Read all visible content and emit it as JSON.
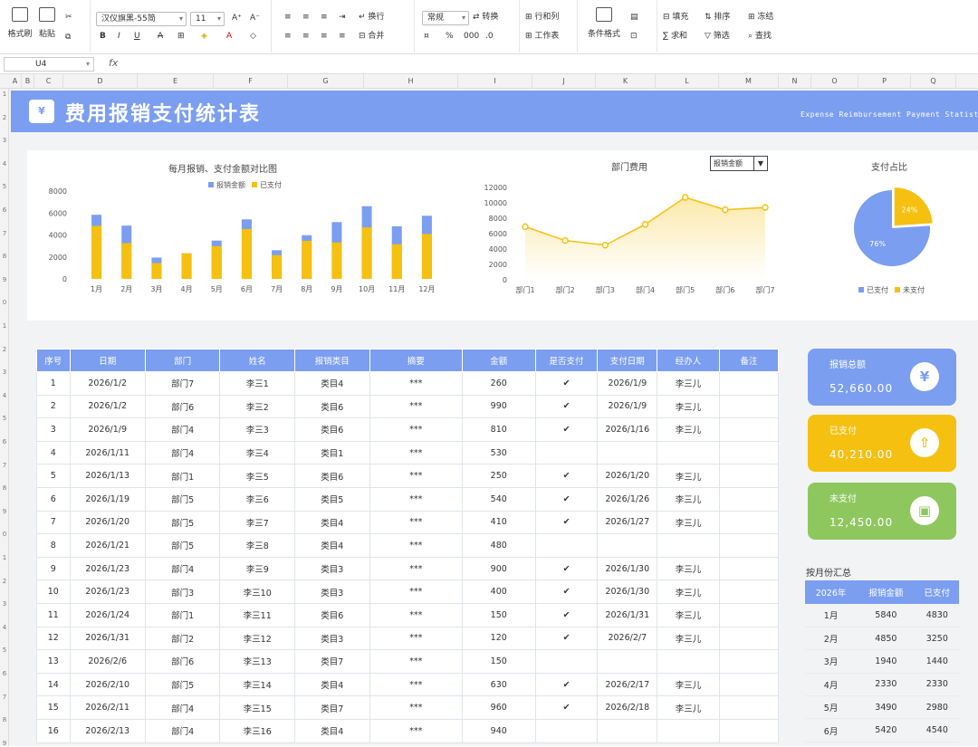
{
  "ribbon": {
    "format_painter": "格式刷",
    "paste": "粘贴",
    "font_name": "汉仪旗黑-55简",
    "font_size": "11",
    "wrap": "换行",
    "merge": "合并",
    "number_format": "常规",
    "convert": "转换",
    "row_col": "行和列",
    "worksheet": "工作表",
    "cond_format": "条件格式",
    "fill": "填充",
    "sort": "排序",
    "freeze": "冻结",
    "sum": "求和",
    "filter": "筛选",
    "find": "查找"
  },
  "formula_bar": {
    "name_box": "U4",
    "fx": "fx"
  },
  "columns": [
    "A",
    "B",
    "C",
    "D",
    "E",
    "F",
    "G",
    "H",
    "I",
    "J",
    "K",
    "L",
    "M",
    "N",
    "O",
    "P",
    "Q"
  ],
  "rows": [
    "1",
    "2",
    "3",
    "4",
    "5",
    "6",
    "7",
    "8",
    "9",
    "0",
    "1",
    "2",
    "3",
    "4",
    "5",
    "6",
    "7",
    "8",
    "9",
    "0",
    "1",
    "2",
    "3",
    "4",
    "5",
    "6",
    "7",
    "8",
    "9"
  ],
  "banner": {
    "icon": "¥",
    "title": "费用报销支付统计表",
    "subtitle": "Expense Reimbursement Payment Statistics"
  },
  "chart1": {
    "title": "每月报销、支付金额对比图"
  },
  "chart2": {
    "title": "部门费用",
    "dropdown": "报销金额"
  },
  "chart3": {
    "title": "支付占比"
  },
  "chart_data": [
    {
      "type": "bar",
      "title": "每月报销、支付金额对比图",
      "categories": [
        "1月",
        "2月",
        "3月",
        "4月",
        "5月",
        "6月",
        "7月",
        "8月",
        "9月",
        "10月",
        "11月",
        "12月"
      ],
      "series": [
        {
          "name": "报销金额",
          "color": "#7b9ef0",
          "values": [
            5840,
            4850,
            1940,
            2330,
            3490,
            5420,
            2610,
            3980,
            5170,
            6620,
            4790,
            5750
          ]
        },
        {
          "name": "已支付",
          "color": "#f5c00f",
          "values": [
            4830,
            3250,
            1440,
            2330,
            2980,
            4540,
            2160,
            3470,
            3320,
            4690,
            3150,
            4090
          ]
        }
      ],
      "ylim": [
        0,
        8000
      ],
      "yticks": [
        0,
        2000,
        4000,
        6000,
        8000
      ],
      "legend": "top"
    },
    {
      "type": "area",
      "title": "部门费用",
      "categories": [
        "部门1",
        "部门2",
        "部门3",
        "部门4",
        "部门5",
        "部门6",
        "部门7"
      ],
      "values": [
        6900,
        5100,
        4500,
        7200,
        10700,
        9100,
        9400
      ],
      "color": "#f5c00f",
      "ylim": [
        0,
        12000
      ],
      "yticks": [
        0,
        2000,
        4000,
        6000,
        8000,
        10000,
        12000
      ]
    },
    {
      "type": "pie",
      "title": "支付占比",
      "labels": [
        "已支付",
        "未支付"
      ],
      "values": [
        76,
        24
      ],
      "colors": [
        "#7b9ef0",
        "#f5c00f"
      ],
      "value_labels": [
        "76%",
        "24%"
      ],
      "legend": "bottom"
    }
  ],
  "table": {
    "headers": [
      "序号",
      "日期",
      "部门",
      "姓名",
      "报销类目",
      "摘要",
      "金额",
      "是否支付",
      "支付日期",
      "经办人",
      "备注"
    ],
    "rows": [
      [
        "1",
        "2026/1/2",
        "部门7",
        "李三1",
        "类目4",
        "***",
        "260",
        "✔",
        "2026/1/9",
        "李三儿",
        ""
      ],
      [
        "2",
        "2026/1/2",
        "部门6",
        "李三2",
        "类目6",
        "***",
        "990",
        "✔",
        "2026/1/9",
        "李三儿",
        ""
      ],
      [
        "3",
        "2026/1/9",
        "部门4",
        "李三3",
        "类目6",
        "***",
        "810",
        "✔",
        "2026/1/16",
        "李三儿",
        ""
      ],
      [
        "4",
        "2026/1/11",
        "部门4",
        "李三4",
        "类目1",
        "***",
        "530",
        "",
        "",
        "",
        ""
      ],
      [
        "5",
        "2026/1/13",
        "部门1",
        "李三5",
        "类目6",
        "***",
        "250",
        "✔",
        "2026/1/20",
        "李三儿",
        ""
      ],
      [
        "6",
        "2026/1/19",
        "部门5",
        "李三6",
        "类目5",
        "***",
        "540",
        "✔",
        "2026/1/26",
        "李三儿",
        ""
      ],
      [
        "7",
        "2026/1/20",
        "部门5",
        "李三7",
        "类目4",
        "***",
        "410",
        "✔",
        "2026/1/27",
        "李三儿",
        ""
      ],
      [
        "8",
        "2026/1/21",
        "部门5",
        "李三8",
        "类目4",
        "***",
        "480",
        "",
        "",
        "",
        ""
      ],
      [
        "9",
        "2026/1/23",
        "部门4",
        "李三9",
        "类目3",
        "***",
        "900",
        "✔",
        "2026/1/30",
        "李三儿",
        ""
      ],
      [
        "10",
        "2026/1/23",
        "部门3",
        "李三10",
        "类目3",
        "***",
        "400",
        "✔",
        "2026/1/30",
        "李三儿",
        ""
      ],
      [
        "11",
        "2026/1/24",
        "部门1",
        "李三11",
        "类目6",
        "***",
        "150",
        "✔",
        "2026/1/31",
        "李三儿",
        ""
      ],
      [
        "12",
        "2026/1/31",
        "部门2",
        "李三12",
        "类目3",
        "***",
        "120",
        "✔",
        "2026/2/7",
        "李三儿",
        ""
      ],
      [
        "13",
        "2026/2/6",
        "部门6",
        "李三13",
        "类目7",
        "***",
        "150",
        "",
        "",
        "",
        ""
      ],
      [
        "14",
        "2026/2/10",
        "部门5",
        "李三14",
        "类目4",
        "***",
        "630",
        "✔",
        "2026/2/17",
        "李三儿",
        ""
      ],
      [
        "15",
        "2026/2/11",
        "部门4",
        "李三15",
        "类目7",
        "***",
        "960",
        "✔",
        "2026/2/18",
        "李三儿",
        ""
      ],
      [
        "16",
        "2026/2/13",
        "部门4",
        "李三16",
        "类目4",
        "***",
        "940",
        "",
        "",
        "",
        ""
      ]
    ]
  },
  "cards": [
    {
      "label": "报销总额",
      "value": "52,660.00",
      "color": "#7b9ef0",
      "icon": "¥",
      "icon_name": "yen-icon"
    },
    {
      "label": "已支付",
      "value": "40,210.00",
      "color": "#f5c00f",
      "icon": "⇧",
      "icon_name": "up-arrow-icon"
    },
    {
      "label": "未支付",
      "value": "12,450.00",
      "color": "#8fc75f",
      "icon": "▣",
      "icon_name": "wallet-icon"
    }
  ],
  "summary": {
    "title": "按月份汇总",
    "headers": [
      "2026年",
      "报销金额",
      "已支付"
    ],
    "rows": [
      [
        "1月",
        "5840",
        "4830"
      ],
      [
        "2月",
        "4850",
        "3250"
      ],
      [
        "3月",
        "1940",
        "1440"
      ],
      [
        "4月",
        "2330",
        "2330"
      ],
      [
        "5月",
        "3490",
        "2980"
      ],
      [
        "6月",
        "5420",
        "4540"
      ]
    ]
  }
}
